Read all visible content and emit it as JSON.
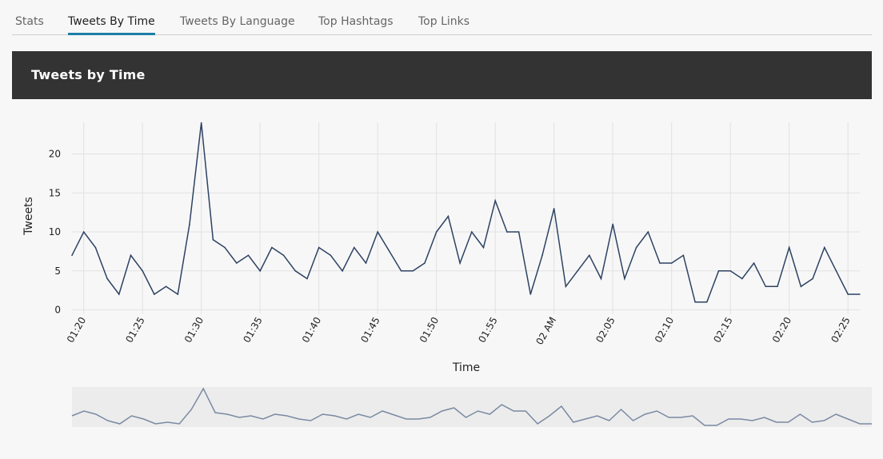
{
  "tabs": [
    {
      "label": "Stats",
      "active": false
    },
    {
      "label": "Tweets By Time",
      "active": true
    },
    {
      "label": "Tweets By Language",
      "active": false
    },
    {
      "label": "Top Hashtags",
      "active": false
    },
    {
      "label": "Top Links",
      "active": false
    }
  ],
  "panel": {
    "title": "Tweets by Time"
  },
  "colors": {
    "line": "#2d4263",
    "grid": "#e2e2e2",
    "accent": "#1d7fa6",
    "header_bg": "#333333",
    "brush_bg": "#ececec",
    "brush_line": "#7a8aa3"
  },
  "chart_data": {
    "type": "line",
    "xlabel": "Time",
    "ylabel": "Tweets",
    "x_start": "01:19",
    "x_step_minutes": 1,
    "x_ticks": [
      "01:20",
      "01:25",
      "01:30",
      "01:35",
      "01:40",
      "01:45",
      "01:50",
      "01:55",
      "02 AM",
      "02:05",
      "02:10",
      "02:15",
      "02:20",
      "02:25"
    ],
    "y_ticks": [
      0,
      5,
      10,
      15,
      20
    ],
    "ylim": [
      0,
      24
    ],
    "grid": true,
    "values": [
      7,
      10,
      8,
      4,
      2,
      7,
      5,
      2,
      3,
      2,
      11,
      24,
      9,
      8,
      6,
      7,
      5,
      8,
      7,
      5,
      4,
      8,
      7,
      5,
      8,
      6,
      10,
      7.5,
      5,
      5,
      6,
      10,
      12,
      6,
      10,
      8,
      14,
      10,
      10,
      2,
      7,
      13,
      3,
      5,
      7,
      4,
      11,
      4,
      8,
      10,
      6,
      6,
      7,
      1,
      1,
      5,
      5,
      4,
      6,
      3,
      3,
      8,
      3,
      4,
      8,
      5,
      2,
      2
    ]
  }
}
